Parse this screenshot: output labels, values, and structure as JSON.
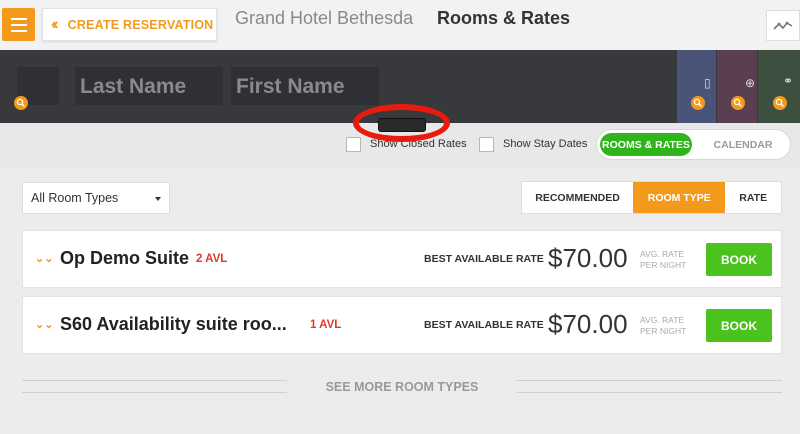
{
  "header": {
    "create_label": "CREATE RESERVATION",
    "hotel_name": "Grand Hotel Bethesda",
    "page_title": "Rooms & Rates"
  },
  "guest": {
    "last_name_placeholder": "Last Name",
    "first_name_placeholder": "First Name"
  },
  "filters": {
    "show_closed_rates": "Show Closed Rates",
    "show_stay_dates": "Show Stay Dates",
    "view_toggle": {
      "active": "ROOMS & RATES",
      "inactive": "CALENDAR"
    }
  },
  "room_filter": {
    "selected": "All Room Types"
  },
  "sort": {
    "recommended": "RECOMMENDED",
    "room_type": "ROOM TYPE",
    "rate": "RATE",
    "active": "ROOM TYPE"
  },
  "rooms": [
    {
      "name": "Op Demo Suite",
      "availability": "2 AVL",
      "rate_label": "BEST AVAILABLE RATE",
      "price": "$70.00",
      "avg_line1": "AVG. RATE",
      "avg_line2": "PER NIGHT",
      "book_label": "BOOK"
    },
    {
      "name": "S60 Availability suite roo...",
      "availability": "1 AVL",
      "rate_label": "BEST AVAILABLE RATE",
      "price": "$70.00",
      "avg_line1": "AVG. RATE",
      "avg_line2": "PER NIGHT",
      "book_label": "BOOK"
    }
  ],
  "see_more": "SEE MORE ROOM TYPES",
  "colors": {
    "accent": "#f39a1c",
    "book": "#4cc21e",
    "toggle_active": "#2fb51b",
    "availability": "#e03a2c",
    "annotation_ring": "#e81b0d"
  }
}
